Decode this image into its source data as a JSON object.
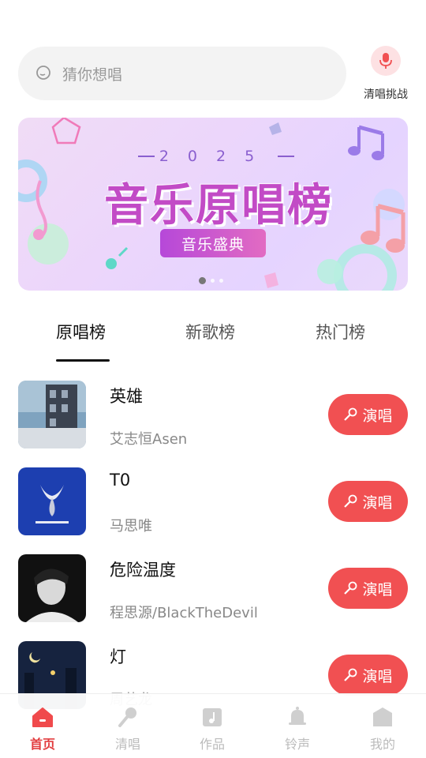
{
  "search": {
    "placeholder": "猜你想唱"
  },
  "challenge": {
    "label": "清唱挑战",
    "icon": "microphone-icon"
  },
  "banner": {
    "year": "2025",
    "title": "音乐原唱榜",
    "subtitle": "音乐盛典",
    "slides": 3,
    "active_slide": 1
  },
  "tabs": [
    {
      "label": "原唱榜",
      "active": true
    },
    {
      "label": "新歌榜",
      "active": false
    },
    {
      "label": "热门榜",
      "active": false
    }
  ],
  "songs": [
    {
      "title": "英雄",
      "artist": "艾志恒Asen",
      "button": "演唱"
    },
    {
      "title": "T0",
      "artist": "马思唯",
      "button": "演唱"
    },
    {
      "title": "危险温度",
      "artist": "程思源/BlackTheDevil",
      "button": "演唱"
    },
    {
      "title": "灯",
      "artist": "周艺龙",
      "button": "演唱"
    }
  ],
  "nav": [
    {
      "label": "首页",
      "icon": "home-icon",
      "active": true
    },
    {
      "label": "清唱",
      "icon": "microphone-icon",
      "active": false
    },
    {
      "label": "作品",
      "icon": "music-box-icon",
      "active": false
    },
    {
      "label": "铃声",
      "icon": "bell-icon",
      "active": false
    },
    {
      "label": "我的",
      "icon": "user-icon",
      "active": false
    }
  ],
  "colors": {
    "accent": "#f15052",
    "nav_active": "#e23d3f",
    "banner_title": "#c24bc6"
  }
}
